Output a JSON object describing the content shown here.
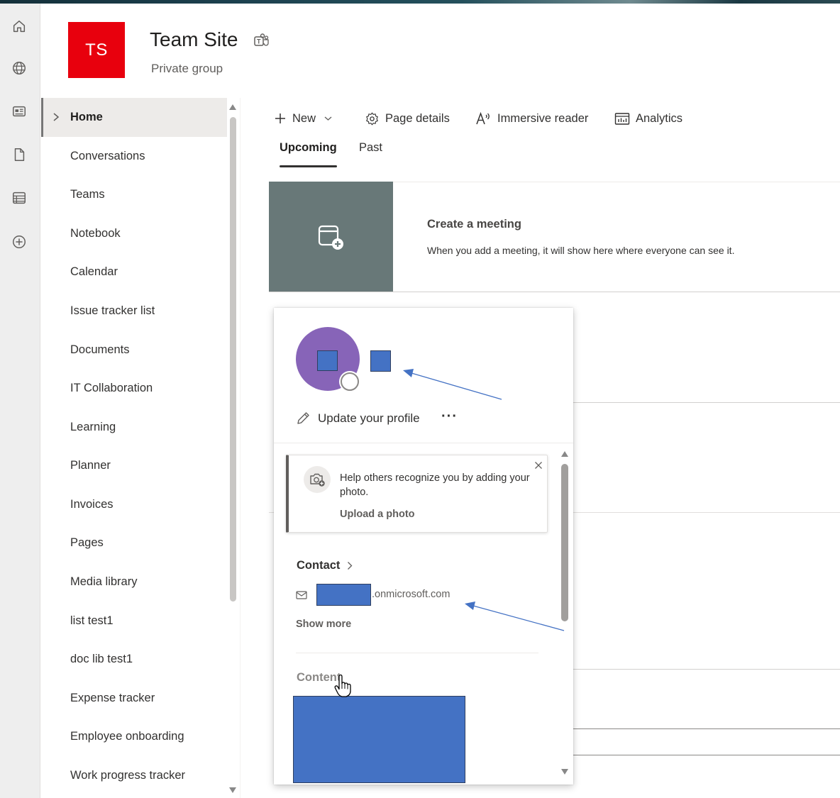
{
  "site": {
    "logo_initials": "TS",
    "title": "Team Site",
    "subtitle": "Private group"
  },
  "appbar": {
    "icons": [
      "home-icon",
      "globe-icon",
      "news-icon",
      "file-icon",
      "lists-icon",
      "create-icon"
    ]
  },
  "nav": {
    "items": [
      {
        "label": "Home",
        "active": true
      },
      {
        "label": "Conversations"
      },
      {
        "label": "Teams"
      },
      {
        "label": "Notebook"
      },
      {
        "label": "Calendar"
      },
      {
        "label": "Issue tracker list"
      },
      {
        "label": "Documents"
      },
      {
        "label": "IT Collaboration"
      },
      {
        "label": "Learning"
      },
      {
        "label": "Planner"
      },
      {
        "label": "Invoices"
      },
      {
        "label": "Pages"
      },
      {
        "label": "Media library"
      },
      {
        "label": "list test1"
      },
      {
        "label": "doc lib test1"
      },
      {
        "label": "Expense tracker"
      },
      {
        "label": "Employee onboarding"
      },
      {
        "label": "Work progress tracker"
      }
    ]
  },
  "commandbar": {
    "new_label": "New",
    "page_details_label": "Page details",
    "immersive_reader_label": "Immersive reader",
    "analytics_label": "Analytics"
  },
  "tabs": {
    "upcoming": "Upcoming",
    "past": "Past"
  },
  "event": {
    "title": "Create a meeting",
    "description": "When you add a meeting, it will show here where everyone can see it."
  },
  "profile_card": {
    "update_profile_label": "Update your profile",
    "more_label": "···",
    "photo_prompt": "Help others recognize you by adding your photo.",
    "upload_photo_label": "Upload a photo",
    "contact_heading": "Contact",
    "email_suffix": ".onmicrosoft.com",
    "show_more_label": "Show more",
    "content_heading": "Content"
  },
  "colors": {
    "logo_bg": "#e8000d",
    "avatar_bg": "#8764b8",
    "redaction": "#4472c4",
    "event_thumb": "#687878",
    "annotation_arrow": "#4472c4"
  }
}
